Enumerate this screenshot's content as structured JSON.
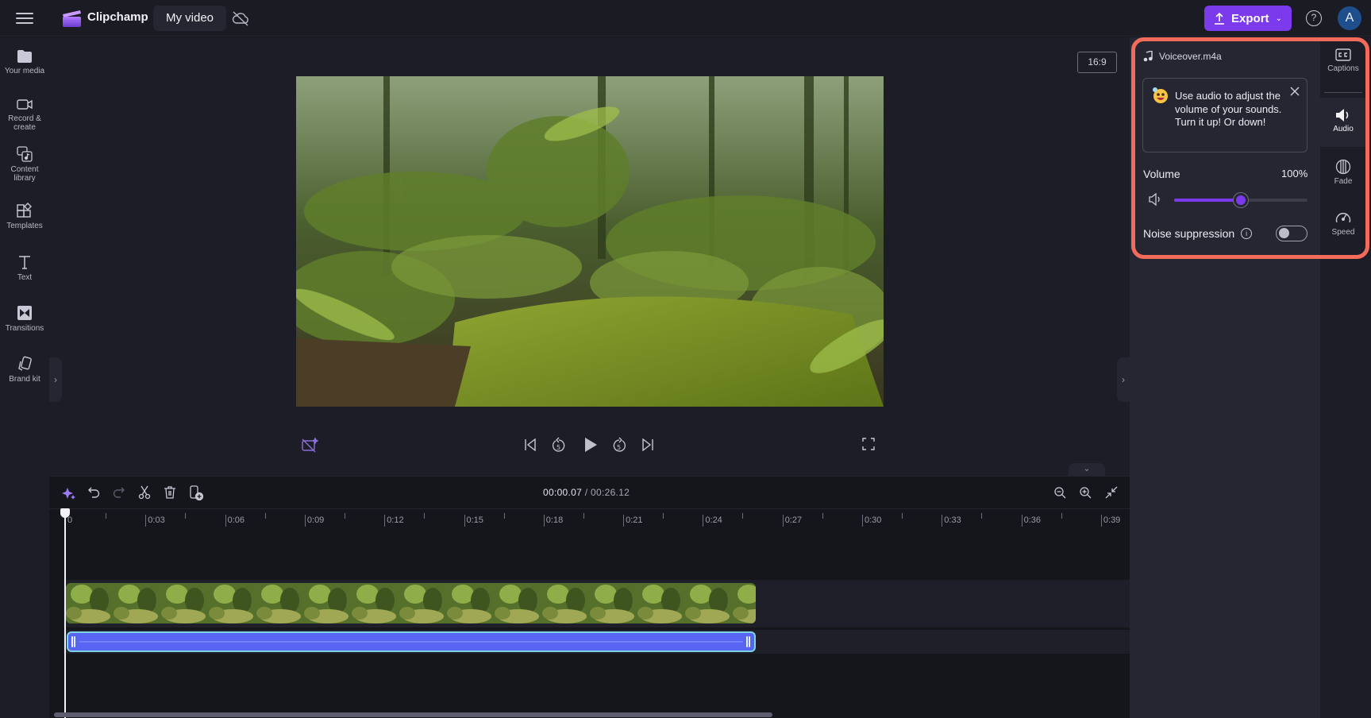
{
  "topbar": {
    "brand": "Clipchamp",
    "project_title": "My video",
    "export_label": "Export",
    "help_label": "?",
    "avatar_initial": "A",
    "accent_color": "#7c3aed"
  },
  "sidebar": {
    "items": [
      {
        "label1": "Your media",
        "label2": "",
        "icon": "folder-icon"
      },
      {
        "label1": "Record &",
        "label2": "create",
        "icon": "camera-icon"
      },
      {
        "label1": "Content",
        "label2": "library",
        "icon": "content-library-icon"
      },
      {
        "label1": "Templates",
        "label2": "",
        "icon": "templates-icon"
      },
      {
        "label1": "Text",
        "label2": "",
        "icon": "text-icon"
      },
      {
        "label1": "Transitions",
        "label2": "",
        "icon": "transitions-icon"
      },
      {
        "label1": "Brand kit",
        "label2": "",
        "icon": "brand-kit-icon"
      }
    ]
  },
  "preview": {
    "aspect_ratio": "16:9",
    "expand_left": "›",
    "expand_right": "›",
    "collapse": "⌄"
  },
  "timeline": {
    "current_time": "00:00.07",
    "separator": " / ",
    "total_time": "00:26.12",
    "ticks": [
      "0",
      "0:03",
      "0:06",
      "0:09",
      "0:12",
      "0:15",
      "0:18",
      "0:21",
      "0:24",
      "0:27",
      "0:30",
      "0:33",
      "0:36",
      "0:39"
    ],
    "scroll_fraction": 0.66
  },
  "audio_panel": {
    "file_name": "Voiceover.m4a",
    "tip_text": "Use audio to adjust the volume of your sounds. Turn it up! Or down!",
    "volume_label": "Volume",
    "volume_value": "100%",
    "volume_slider_fraction": 0.5,
    "noise_label": "Noise suppression",
    "noise_info": "i",
    "noise_enabled": false,
    "highlight_color": "#f26b5b"
  },
  "rail": {
    "items": [
      {
        "label": "Captions",
        "icon": "captions-icon",
        "active": false
      },
      {
        "label": "Audio",
        "icon": "audio-icon",
        "active": true
      },
      {
        "label": "Fade",
        "icon": "fade-icon",
        "active": false
      },
      {
        "label": "Speed",
        "icon": "speed-icon",
        "active": false
      }
    ]
  }
}
